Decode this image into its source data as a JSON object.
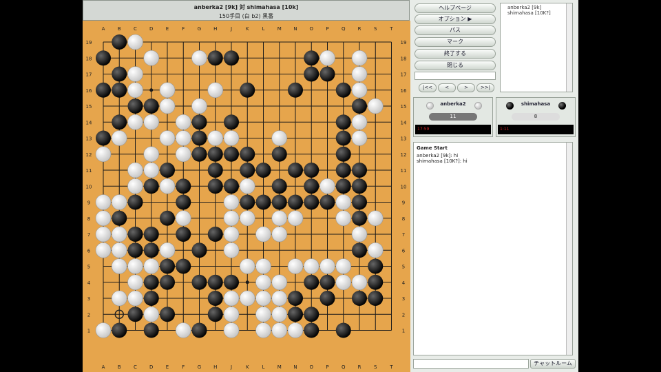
{
  "game": {
    "title": "anberka2 [9k] 対 shimahasa [10k]",
    "subtitle": "150手目 (白 b2) 黒番"
  },
  "board": {
    "columns": [
      "A",
      "B",
      "C",
      "D",
      "E",
      "F",
      "G",
      "H",
      "J",
      "K",
      "L",
      "M",
      "N",
      "O",
      "P",
      "Q",
      "R",
      "S",
      "T"
    ],
    "rows": [
      "19",
      "18",
      "17",
      "16",
      "15",
      "14",
      "13",
      "12",
      "11",
      "10",
      "9",
      "8",
      "7",
      "6",
      "5",
      "4",
      "3",
      "2",
      "1"
    ],
    "black": [
      "B1",
      "D1",
      "G1",
      "O1",
      "Q1",
      "C2",
      "E2",
      "H2",
      "N2",
      "O2",
      "D3",
      "H3",
      "N3",
      "P3",
      "R3",
      "S3",
      "D4",
      "E4",
      "G4",
      "H4",
      "J4",
      "O4",
      "P4",
      "S4",
      "E5",
      "F5",
      "S5",
      "C6",
      "D6",
      "G6",
      "R6",
      "C7",
      "D7",
      "F7",
      "H7",
      "B8",
      "E8",
      "R8",
      "C9",
      "F9",
      "K9",
      "L9",
      "M9",
      "N9",
      "O9",
      "P9",
      "R9",
      "D10",
      "F10",
      "H10",
      "J10",
      "M10",
      "O10",
      "Q10",
      "R10",
      "E11",
      "H11",
      "K11",
      "L11",
      "N11",
      "O11",
      "Q11",
      "R11",
      "G12",
      "H12",
      "J12",
      "K12",
      "M12",
      "Q12",
      "A13",
      "G13",
      "J13",
      "Q13",
      "B14",
      "G14",
      "J14",
      "Q14",
      "C15",
      "D15",
      "R15",
      "A16",
      "B16",
      "K16",
      "N16",
      "Q16",
      "B17",
      "O17",
      "P17",
      "A18",
      "H18",
      "J18",
      "O18",
      "B19"
    ],
    "white": [
      "A1",
      "F1",
      "J1",
      "L1",
      "M1",
      "N1",
      "C3",
      "D2",
      "I2",
      "L2",
      "M2",
      "B3",
      "J3",
      "K3",
      "L3",
      "M3",
      "D5",
      "C4",
      "L4",
      "M4",
      "Q4",
      "R4",
      "B5",
      "C5",
      "D5",
      "K5",
      "L5",
      "N5",
      "O5",
      "P5",
      "Q5",
      "A6",
      "B6",
      "E6",
      "J6",
      "R6",
      "S6",
      "A7",
      "B7",
      "J7",
      "L7",
      "M7",
      "R7",
      "A8",
      "B8",
      "F8",
      "J8",
      "K8",
      "M8",
      "N8",
      "Q8",
      "S8",
      "A9",
      "B9",
      "J9",
      "L9",
      "N9",
      "Q9",
      "C10",
      "E10",
      "K10",
      "P10",
      "R10",
      "C11",
      "D11",
      "E11",
      "A12",
      "D12",
      "F12",
      "B13",
      "E13",
      "F13",
      "H13",
      "I13",
      "M13",
      "R13",
      "C14",
      "D14",
      "F14",
      "R14",
      "E15",
      "G15",
      "S15",
      "C16",
      "E16",
      "H16",
      "R16",
      "C17",
      "R17",
      "D18",
      "G18",
      "P18",
      "R18",
      "C19"
    ],
    "last_move": "B2",
    "colors": {
      "board": "#e6a54c",
      "line": "#1a1a1a"
    }
  },
  "buttons": {
    "help": "ヘルプページ",
    "options": "オプション",
    "pass": "パス",
    "mark": "マーク",
    "finish": "終了する",
    "close": "閉じる"
  },
  "nav": {
    "first": "|<<",
    "prev": "<",
    "next": ">",
    "last": ">>|"
  },
  "players_list": [
    "anberka2 [9k]",
    "shimahasa [10K?]"
  ],
  "white_panel": {
    "name": "anberka2",
    "captures": "11",
    "time": "17:59"
  },
  "black_panel": {
    "name": "shimahasa",
    "captures": "8",
    "time": "1:11"
  },
  "chat": {
    "header": "Game Start",
    "lines": [
      "anberka2 [9k]: hi",
      "shimahasa [10K?]: hi"
    ],
    "button": "チャットルーム"
  }
}
